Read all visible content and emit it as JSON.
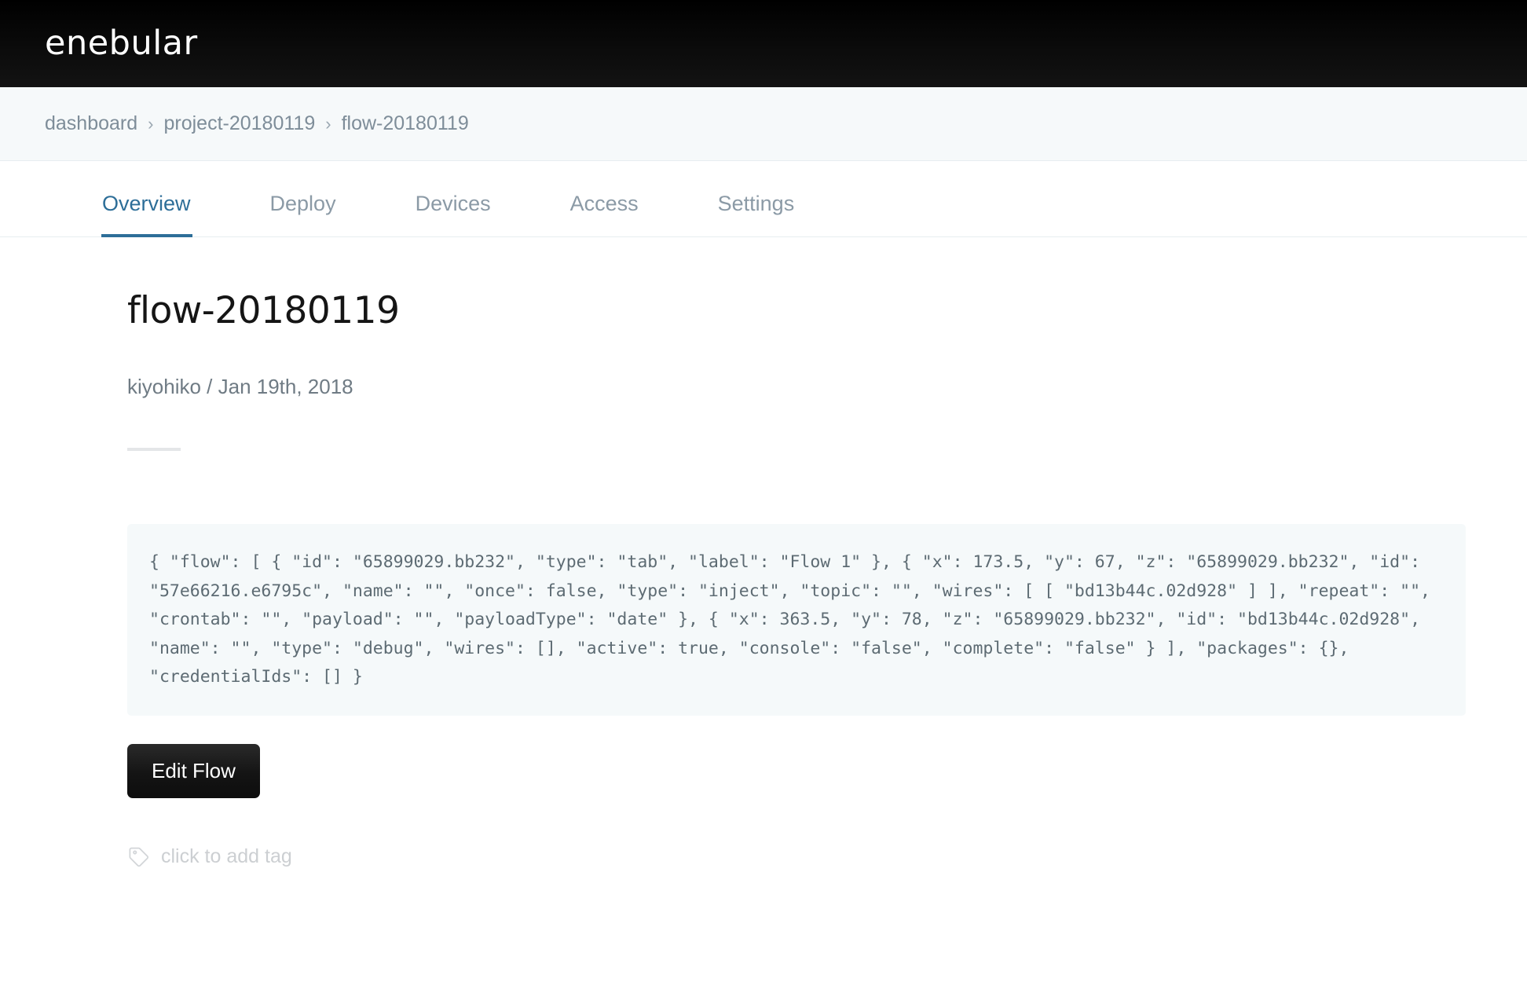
{
  "header": {
    "logo_text": "enebular",
    "background_color": "#000000"
  },
  "breadcrumb": {
    "separator": "›",
    "items": [
      {
        "label": "dashboard"
      },
      {
        "label": "project-20180119"
      },
      {
        "label": "flow-20180119"
      }
    ]
  },
  "tabs": {
    "active_color": "#2d6e98",
    "inactive_color": "#8b9aa6",
    "items": [
      {
        "label": "Overview",
        "active": true
      },
      {
        "label": "Deploy",
        "active": false
      },
      {
        "label": "Devices",
        "active": false
      },
      {
        "label": "Access",
        "active": false
      },
      {
        "label": "Settings",
        "active": false
      }
    ]
  },
  "main": {
    "title": "flow-20180119",
    "byline": "kiyohiko / Jan 19th, 2018",
    "code": "{ \"flow\": [ { \"id\": \"65899029.bb232\", \"type\": \"tab\", \"label\": \"Flow 1\" }, { \"x\": 173.5, \"y\": 67, \"z\": \"65899029.bb232\", \"id\": \"57e66216.e6795c\", \"name\": \"\", \"once\": false, \"type\": \"inject\", \"topic\": \"\", \"wires\": [ [ \"bd13b44c.02d928\" ] ], \"repeat\": \"\", \"crontab\": \"\", \"payload\": \"\", \"payloadType\": \"date\" }, { \"x\": 363.5, \"y\": 78, \"z\": \"65899029.bb232\", \"id\": \"bd13b44c.02d928\", \"name\": \"\", \"type\": \"debug\", \"wires\": [], \"active\": true, \"console\": \"false\", \"complete\": \"false\" } ], \"packages\": {}, \"credentialIds\": [] }",
    "edit_button_label": "Edit Flow",
    "tag_placeholder": "click to add tag",
    "tag_icon": "tag-icon"
  }
}
